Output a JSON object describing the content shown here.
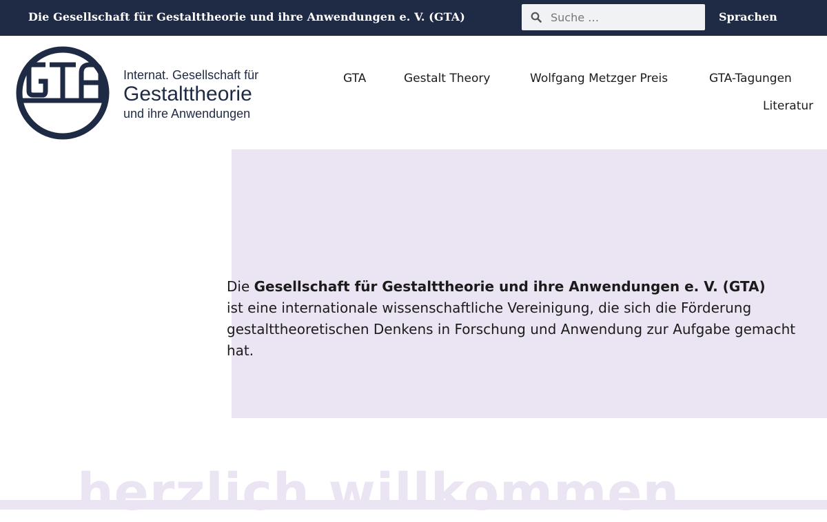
{
  "topbar": {
    "site_title": "Die Gesellschaft für Gestalttheorie und ihre Anwendungen e. V. (GTA)",
    "search": {
      "placeholder": "Suche …",
      "icon": "search-icon"
    },
    "language_label": "Sprachen"
  },
  "logo": {
    "mark": "GTA",
    "line1": "Internat. Gesellschaft für",
    "line2": "Gestalttheorie",
    "line3": "und ihre Anwendungen"
  },
  "nav": {
    "items": [
      "GTA",
      "Gestalt Theory",
      "Wolfgang Metzger Preis",
      "GTA-Tagungen",
      "Literatur"
    ]
  },
  "hero": {
    "intro_prefix": "Die ",
    "intro_bold": "Gesellschaft für Gestalttheorie und ihre Anwendungen e. V. (GTA)",
    "intro_rest": "ist eine internationale wissenschaftliche Vereinigung, die sich die Förderung gestalttheoretischen Denkens in Forschung und Anwendung zur Aufgabe gemacht hat."
  },
  "welcome": {
    "text": "herzlich willkommen"
  },
  "colors": {
    "topbar": "#1f2a44",
    "accent_bg": "#ebe4f3",
    "logo": "#1f2a44"
  }
}
